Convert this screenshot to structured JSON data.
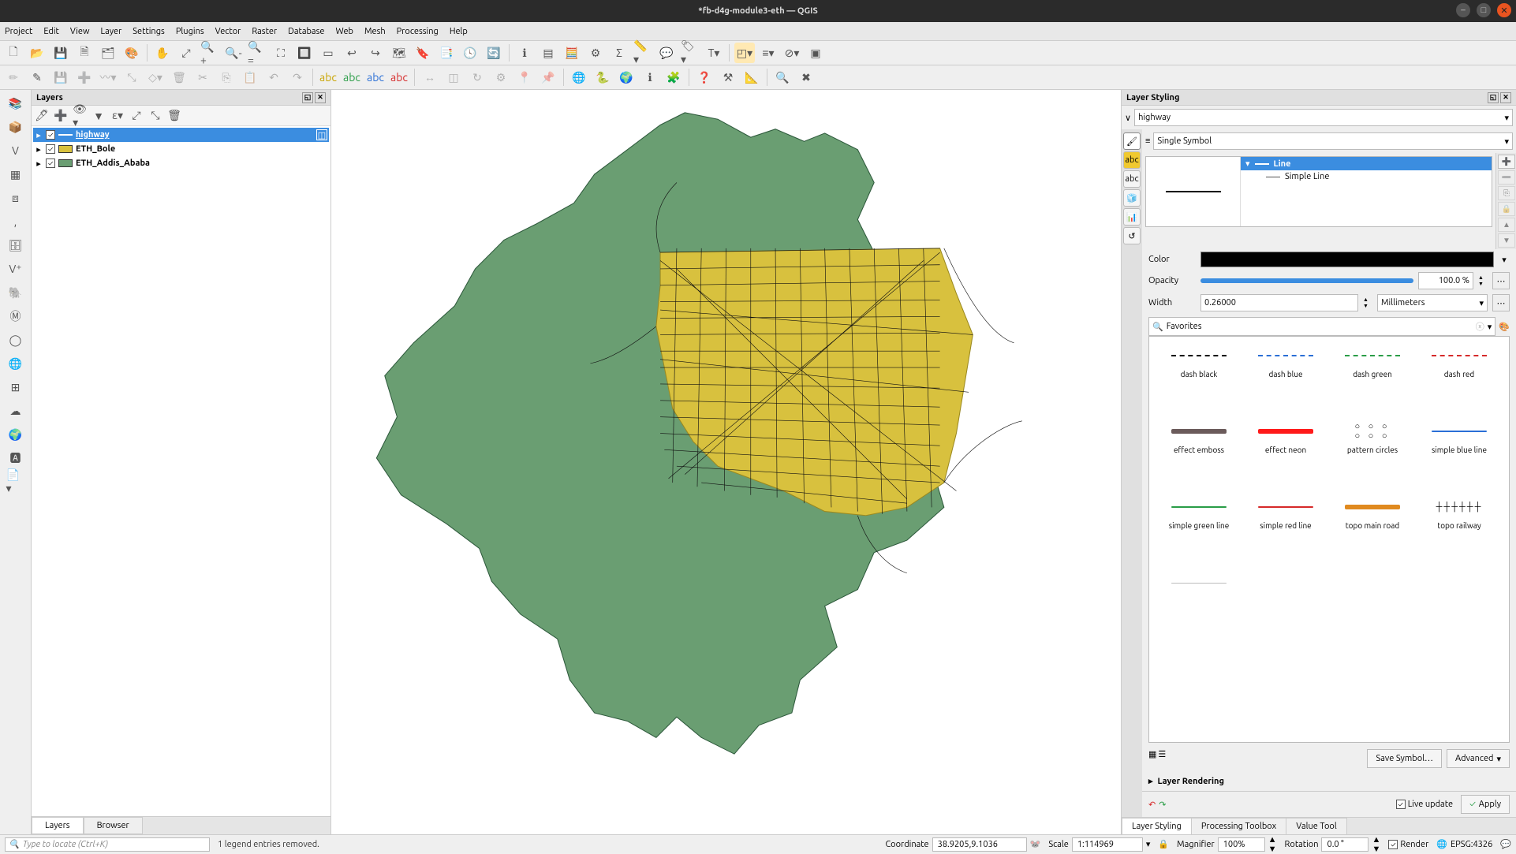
{
  "window": {
    "title": "*fb-d4g-module3-eth — QGIS"
  },
  "menu": [
    "Project",
    "Edit",
    "View",
    "Layer",
    "Settings",
    "Plugins",
    "Vector",
    "Raster",
    "Database",
    "Web",
    "Mesh",
    "Processing",
    "Help"
  ],
  "layersPanel": {
    "title": "Layers",
    "items": [
      {
        "name": "highway",
        "checked": true,
        "type": "line",
        "selected": true
      },
      {
        "name": "ETH_Bole",
        "checked": true,
        "type": "poly",
        "color": "#d8c13e"
      },
      {
        "name": "ETH_Addis_Ababa",
        "checked": true,
        "type": "poly",
        "color": "#6a9e72"
      }
    ],
    "tabs": [
      "Layers",
      "Browser"
    ],
    "activeTab": "Layers"
  },
  "styling": {
    "title": "Layer Styling",
    "layer": "highway",
    "renderer": "Single Symbol",
    "tree": [
      {
        "label": "Line",
        "selected": true
      },
      {
        "label": "Simple Line",
        "selected": false
      }
    ],
    "color": "#000000",
    "opacity_label": "Opacity",
    "opacity": "100.0 %",
    "width_label": "Width",
    "width": "0.26000",
    "unit": "Millimeters",
    "search": "Favorites",
    "swatches": [
      {
        "name": "dash black",
        "style": "dashed",
        "color": "#000"
      },
      {
        "name": "dash blue",
        "style": "dashed",
        "color": "#2a6fd6"
      },
      {
        "name": "dash green",
        "style": "dashed",
        "color": "#2a9d47"
      },
      {
        "name": "dash red",
        "style": "dashed",
        "color": "#d62a2a"
      },
      {
        "name": "effect emboss",
        "style": "solid",
        "color": "#6b5b5b"
      },
      {
        "name": "effect neon",
        "style": "solid",
        "color": "#ff1a1a"
      },
      {
        "name": "pattern circles",
        "style": "circles",
        "color": "#000"
      },
      {
        "name": "simple blue line",
        "style": "thin",
        "color": "#2a6fd6"
      },
      {
        "name": "simple green line",
        "style": "thin",
        "color": "#2a9d47"
      },
      {
        "name": "simple red line",
        "style": "thin",
        "color": "#d62a2a"
      },
      {
        "name": "topo main road",
        "style": "solid",
        "color": "#e08a1f"
      },
      {
        "name": "topo railway",
        "style": "ticks",
        "color": "#000"
      }
    ],
    "saveBtn": "Save Symbol…",
    "advancedBtn": "Advanced",
    "section": "Layer Rendering",
    "liveUpdate": "Live update",
    "applyBtn": "Apply",
    "bottomTabs": [
      "Layer Styling",
      "Processing Toolbox",
      "Value Tool"
    ],
    "activeBottom": "Layer Styling",
    "color_label": "Color"
  },
  "status": {
    "locator": "Type to locate (Ctrl+K)",
    "msg": "1 legend entries removed.",
    "coordLabel": "Coordinate",
    "coord": "38.9205,9.1036",
    "scaleLabel": "Scale",
    "scale": "1:114969",
    "magLabel": "Magnifier",
    "mag": "100%",
    "rotLabel": "Rotation",
    "rot": "0.0 °",
    "renderLabel": "Render",
    "crs": "EPSG:4326"
  }
}
